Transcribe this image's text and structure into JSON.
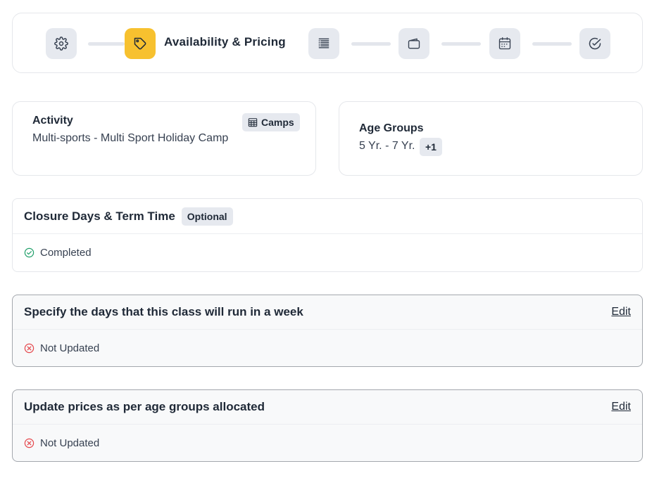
{
  "stepper": {
    "active_step_label": "Availability & Pricing",
    "steps": [
      {
        "icon": "gear-icon"
      },
      {
        "icon": "tag-icon"
      },
      {
        "icon": "list-icon"
      },
      {
        "icon": "wallet-icon"
      },
      {
        "icon": "calendar-icon"
      },
      {
        "icon": "check-circle-icon"
      }
    ]
  },
  "activity": {
    "label": "Activity",
    "value": "Multi-sports - Multi Sport Holiday Camp",
    "tag": "Camps"
  },
  "age_groups": {
    "label": "Age Groups",
    "value": "5 Yr. - 7 Yr.",
    "more": "+1"
  },
  "closure": {
    "title": "Closure Days & Term Time",
    "badge": "Optional",
    "status": "Completed"
  },
  "days": {
    "title": "Specify the days that this class will run in a week",
    "edit": "Edit",
    "status": "Not Updated"
  },
  "prices": {
    "title": "Update prices as per age groups allocated",
    "edit": "Edit",
    "status": "Not Updated"
  },
  "colors": {
    "accent": "#f7c12f",
    "success": "#22a06b",
    "error": "#e5484d"
  }
}
